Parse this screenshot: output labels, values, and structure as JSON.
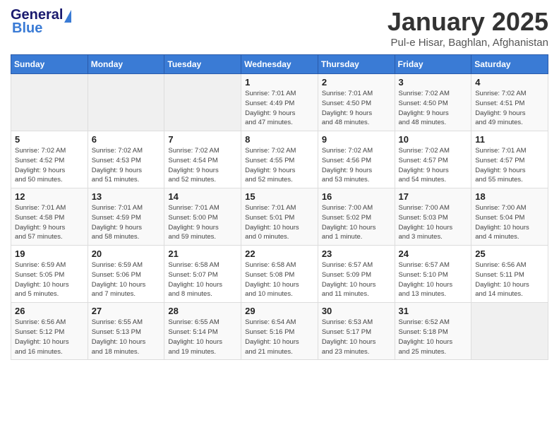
{
  "logo": {
    "text_general": "General",
    "text_blue": "Blue"
  },
  "title": "January 2025",
  "subtitle": "Pul-e Hisar, Baghlan, Afghanistan",
  "days_of_week": [
    "Sunday",
    "Monday",
    "Tuesday",
    "Wednesday",
    "Thursday",
    "Friday",
    "Saturday"
  ],
  "weeks": [
    [
      {
        "day": "",
        "info": ""
      },
      {
        "day": "",
        "info": ""
      },
      {
        "day": "",
        "info": ""
      },
      {
        "day": "1",
        "info": "Sunrise: 7:01 AM\nSunset: 4:49 PM\nDaylight: 9 hours\nand 47 minutes."
      },
      {
        "day": "2",
        "info": "Sunrise: 7:01 AM\nSunset: 4:50 PM\nDaylight: 9 hours\nand 48 minutes."
      },
      {
        "day": "3",
        "info": "Sunrise: 7:02 AM\nSunset: 4:50 PM\nDaylight: 9 hours\nand 48 minutes."
      },
      {
        "day": "4",
        "info": "Sunrise: 7:02 AM\nSunset: 4:51 PM\nDaylight: 9 hours\nand 49 minutes."
      }
    ],
    [
      {
        "day": "5",
        "info": "Sunrise: 7:02 AM\nSunset: 4:52 PM\nDaylight: 9 hours\nand 50 minutes."
      },
      {
        "day": "6",
        "info": "Sunrise: 7:02 AM\nSunset: 4:53 PM\nDaylight: 9 hours\nand 51 minutes."
      },
      {
        "day": "7",
        "info": "Sunrise: 7:02 AM\nSunset: 4:54 PM\nDaylight: 9 hours\nand 52 minutes."
      },
      {
        "day": "8",
        "info": "Sunrise: 7:02 AM\nSunset: 4:55 PM\nDaylight: 9 hours\nand 52 minutes."
      },
      {
        "day": "9",
        "info": "Sunrise: 7:02 AM\nSunset: 4:56 PM\nDaylight: 9 hours\nand 53 minutes."
      },
      {
        "day": "10",
        "info": "Sunrise: 7:02 AM\nSunset: 4:57 PM\nDaylight: 9 hours\nand 54 minutes."
      },
      {
        "day": "11",
        "info": "Sunrise: 7:01 AM\nSunset: 4:57 PM\nDaylight: 9 hours\nand 55 minutes."
      }
    ],
    [
      {
        "day": "12",
        "info": "Sunrise: 7:01 AM\nSunset: 4:58 PM\nDaylight: 9 hours\nand 57 minutes."
      },
      {
        "day": "13",
        "info": "Sunrise: 7:01 AM\nSunset: 4:59 PM\nDaylight: 9 hours\nand 58 minutes."
      },
      {
        "day": "14",
        "info": "Sunrise: 7:01 AM\nSunset: 5:00 PM\nDaylight: 9 hours\nand 59 minutes."
      },
      {
        "day": "15",
        "info": "Sunrise: 7:01 AM\nSunset: 5:01 PM\nDaylight: 10 hours\nand 0 minutes."
      },
      {
        "day": "16",
        "info": "Sunrise: 7:00 AM\nSunset: 5:02 PM\nDaylight: 10 hours\nand 1 minute."
      },
      {
        "day": "17",
        "info": "Sunrise: 7:00 AM\nSunset: 5:03 PM\nDaylight: 10 hours\nand 3 minutes."
      },
      {
        "day": "18",
        "info": "Sunrise: 7:00 AM\nSunset: 5:04 PM\nDaylight: 10 hours\nand 4 minutes."
      }
    ],
    [
      {
        "day": "19",
        "info": "Sunrise: 6:59 AM\nSunset: 5:05 PM\nDaylight: 10 hours\nand 5 minutes."
      },
      {
        "day": "20",
        "info": "Sunrise: 6:59 AM\nSunset: 5:06 PM\nDaylight: 10 hours\nand 7 minutes."
      },
      {
        "day": "21",
        "info": "Sunrise: 6:58 AM\nSunset: 5:07 PM\nDaylight: 10 hours\nand 8 minutes."
      },
      {
        "day": "22",
        "info": "Sunrise: 6:58 AM\nSunset: 5:08 PM\nDaylight: 10 hours\nand 10 minutes."
      },
      {
        "day": "23",
        "info": "Sunrise: 6:57 AM\nSunset: 5:09 PM\nDaylight: 10 hours\nand 11 minutes."
      },
      {
        "day": "24",
        "info": "Sunrise: 6:57 AM\nSunset: 5:10 PM\nDaylight: 10 hours\nand 13 minutes."
      },
      {
        "day": "25",
        "info": "Sunrise: 6:56 AM\nSunset: 5:11 PM\nDaylight: 10 hours\nand 14 minutes."
      }
    ],
    [
      {
        "day": "26",
        "info": "Sunrise: 6:56 AM\nSunset: 5:12 PM\nDaylight: 10 hours\nand 16 minutes."
      },
      {
        "day": "27",
        "info": "Sunrise: 6:55 AM\nSunset: 5:13 PM\nDaylight: 10 hours\nand 18 minutes."
      },
      {
        "day": "28",
        "info": "Sunrise: 6:55 AM\nSunset: 5:14 PM\nDaylight: 10 hours\nand 19 minutes."
      },
      {
        "day": "29",
        "info": "Sunrise: 6:54 AM\nSunset: 5:16 PM\nDaylight: 10 hours\nand 21 minutes."
      },
      {
        "day": "30",
        "info": "Sunrise: 6:53 AM\nSunset: 5:17 PM\nDaylight: 10 hours\nand 23 minutes."
      },
      {
        "day": "31",
        "info": "Sunrise: 6:52 AM\nSunset: 5:18 PM\nDaylight: 10 hours\nand 25 minutes."
      },
      {
        "day": "",
        "info": ""
      }
    ]
  ]
}
